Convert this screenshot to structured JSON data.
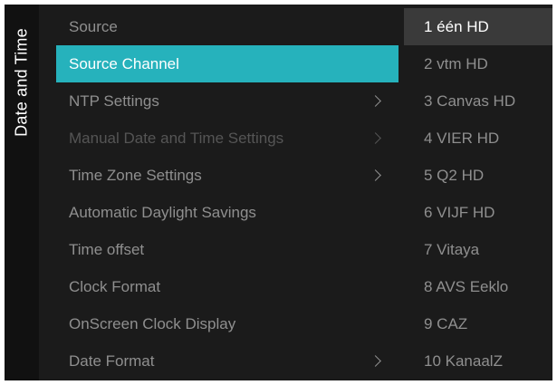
{
  "side_title": "Date and Time",
  "menu": {
    "items": [
      {
        "label": "Source",
        "has_submenu": false,
        "state": "normal"
      },
      {
        "label": "Source Channel",
        "has_submenu": false,
        "state": "selected"
      },
      {
        "label": "NTP Settings",
        "has_submenu": true,
        "state": "normal"
      },
      {
        "label": "Manual Date and Time Settings",
        "has_submenu": true,
        "state": "disabled"
      },
      {
        "label": "Time Zone Settings",
        "has_submenu": true,
        "state": "normal"
      },
      {
        "label": "Automatic Daylight Savings",
        "has_submenu": false,
        "state": "normal"
      },
      {
        "label": "Time offset",
        "has_submenu": false,
        "state": "normal"
      },
      {
        "label": "Clock Format",
        "has_submenu": false,
        "state": "normal"
      },
      {
        "label": "OnScreen Clock Display",
        "has_submenu": false,
        "state": "normal"
      },
      {
        "label": "Date Format",
        "has_submenu": true,
        "state": "normal"
      }
    ]
  },
  "channels": {
    "highlighted_index": 0,
    "items": [
      "1 één HD",
      "2 vtm HD",
      "3 Canvas HD",
      "4 VIER HD",
      "5 Q2 HD",
      "6 VIJF HD",
      "7 Vitaya",
      "8 AVS Eeklo",
      "9 CAZ",
      "10 KanaalZ"
    ]
  },
  "colors": {
    "selected_accent": "#26b2bc",
    "background": "#1b1b1b",
    "text_dim": "#8f8f8f",
    "text_disabled": "#555555",
    "channel_highlight": "#3a3a3a"
  },
  "icons": {
    "submenu": "chevron-right-icon"
  }
}
